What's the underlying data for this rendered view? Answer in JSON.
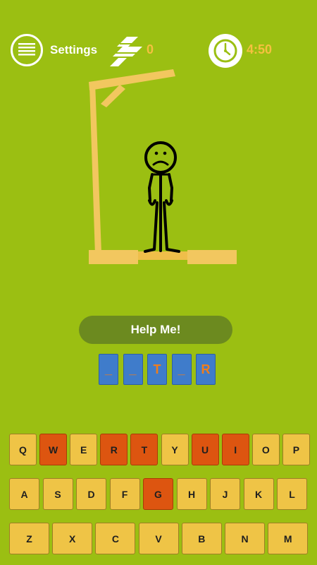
{
  "header": {
    "settings_label": "Settings",
    "hint_count": "0",
    "timer": "4:50",
    "menu_icon": "menu-icon",
    "hint_icon": "hint-icon",
    "timer_icon": "clock-icon"
  },
  "game": {
    "help_label": "Help Me!",
    "word": [
      "_",
      "_",
      "T",
      "_",
      "R"
    ]
  },
  "keyboard": {
    "row1": [
      {
        "key": "Q",
        "used": false
      },
      {
        "key": "W",
        "used": true
      },
      {
        "key": "E",
        "used": false
      },
      {
        "key": "R",
        "used": true
      },
      {
        "key": "T",
        "used": true
      },
      {
        "key": "Y",
        "used": false
      },
      {
        "key": "U",
        "used": true
      },
      {
        "key": "I",
        "used": true
      },
      {
        "key": "O",
        "used": false
      },
      {
        "key": "P",
        "used": false
      }
    ],
    "row2": [
      {
        "key": "A",
        "used": false
      },
      {
        "key": "S",
        "used": false
      },
      {
        "key": "D",
        "used": false
      },
      {
        "key": "F",
        "used": false
      },
      {
        "key": "G",
        "used": true
      },
      {
        "key": "H",
        "used": false
      },
      {
        "key": "J",
        "used": false
      },
      {
        "key": "K",
        "used": false
      },
      {
        "key": "L",
        "used": false
      }
    ],
    "row3": [
      {
        "key": "Z",
        "used": false
      },
      {
        "key": "X",
        "used": false
      },
      {
        "key": "C",
        "used": false
      },
      {
        "key": "V",
        "used": false
      },
      {
        "key": "B",
        "used": false
      },
      {
        "key": "N",
        "used": false
      },
      {
        "key": "M",
        "used": false
      }
    ]
  },
  "colors": {
    "background": "#9bbf12",
    "accent": "#f5c140",
    "used_key": "#dd5510",
    "word_slot": "#3f7ccb"
  }
}
